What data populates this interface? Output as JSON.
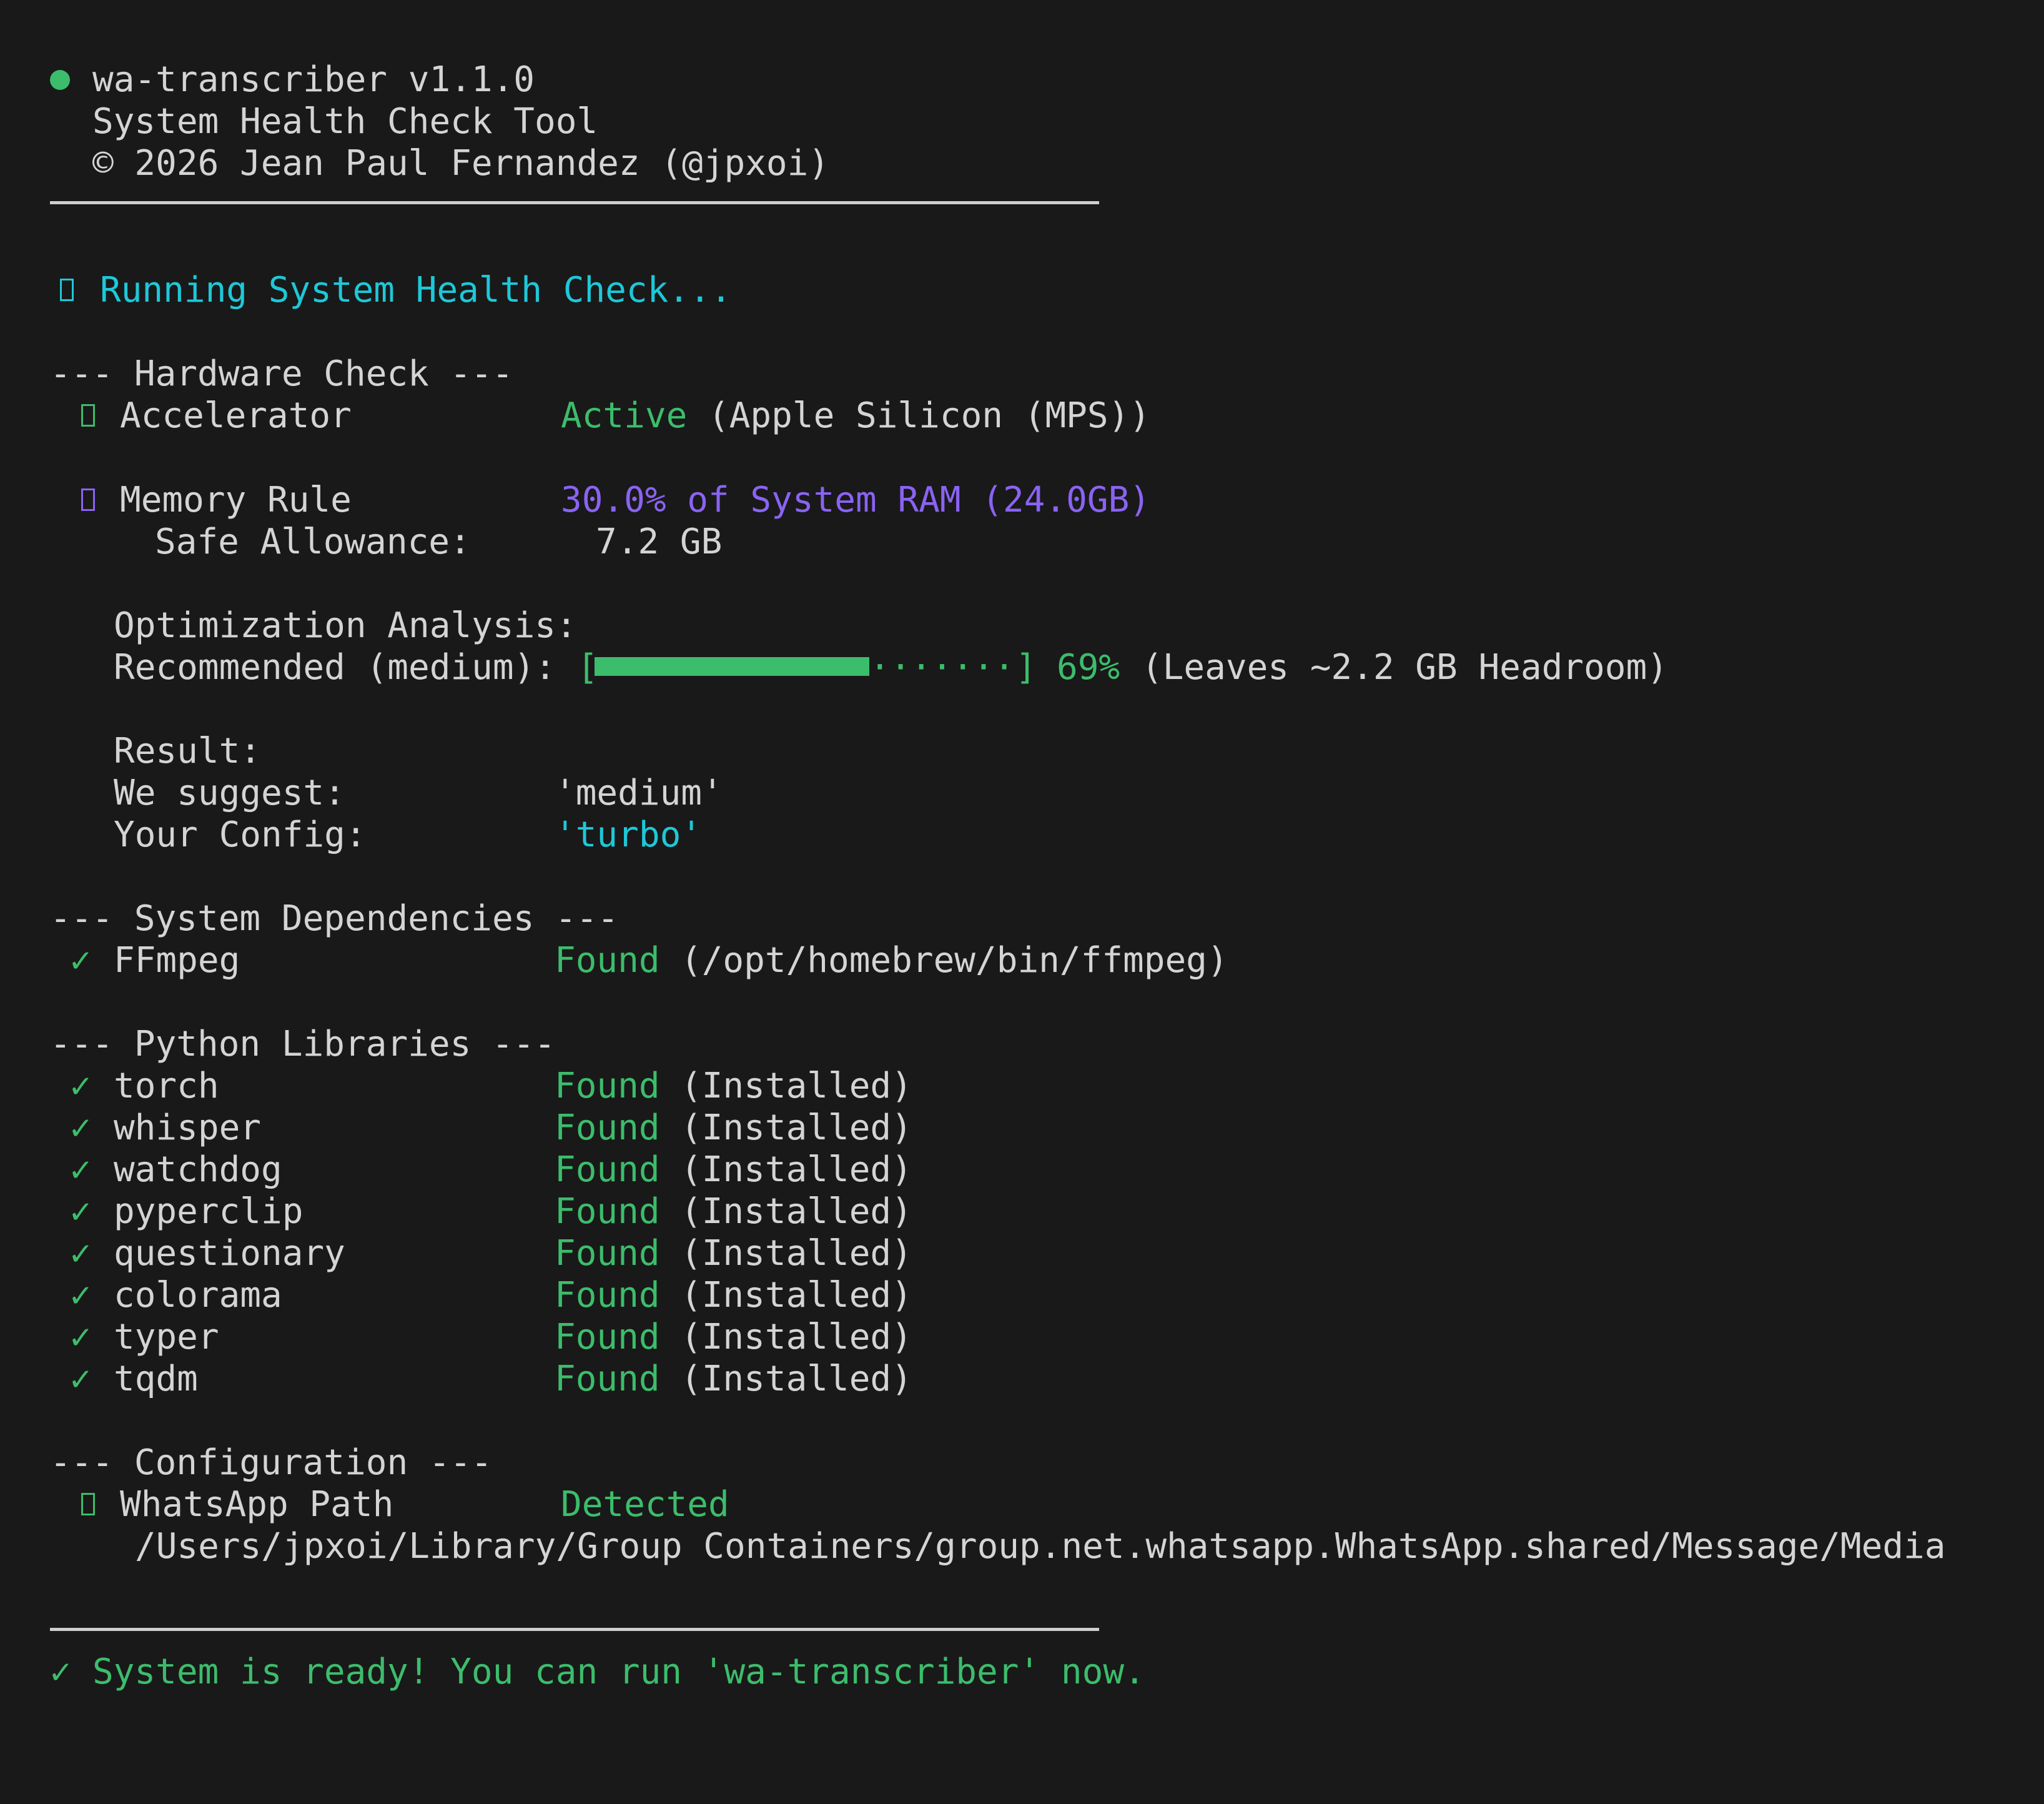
{
  "header": {
    "title": "wa-transcriber v1.1.0",
    "subtitle": "System Health Check Tool",
    "copyright": "© 2026 Jean Paul Fernandez (@jpxoi)"
  },
  "running": "Running System Health Check...",
  "hardware": {
    "heading": "--- Hardware Check ---",
    "accelerator": {
      "label": "Accelerator",
      "status": "Active",
      "detail": "(Apple Silicon (MPS))"
    },
    "memory": {
      "label": "Memory Rule",
      "value": "30.0% of System RAM (24.0GB)"
    },
    "allowance": {
      "label": "Safe Allowance:",
      "value": "7.2 GB"
    },
    "optimization_label": "Optimization Analysis:",
    "recommended": {
      "label": "Recommended (medium):",
      "bar_open": "[",
      "bar_dots": "·······",
      "bar_close": "]",
      "fill_fraction": 0.69,
      "percent": "69%",
      "note": "(Leaves ~2.2 GB Headroom)"
    },
    "result_label": "Result:",
    "suggest": {
      "label": "We suggest:",
      "value": "'medium'"
    },
    "config": {
      "label": "Your Config:",
      "value": "'turbo'"
    }
  },
  "dependencies": {
    "heading": "--- System Dependencies ---",
    "items": [
      {
        "check": "✓",
        "name": "FFmpeg",
        "status": "Found",
        "detail": "(/opt/homebrew/bin/ffmpeg)"
      }
    ]
  },
  "libraries": {
    "heading": "--- Python Libraries ---",
    "items": [
      {
        "check": "✓",
        "name": "torch",
        "status": "Found",
        "detail": "(Installed)"
      },
      {
        "check": "✓",
        "name": "whisper",
        "status": "Found",
        "detail": "(Installed)"
      },
      {
        "check": "✓",
        "name": "watchdog",
        "status": "Found",
        "detail": "(Installed)"
      },
      {
        "check": "✓",
        "name": "pyperclip",
        "status": "Found",
        "detail": "(Installed)"
      },
      {
        "check": "✓",
        "name": "questionary",
        "status": "Found",
        "detail": "(Installed)"
      },
      {
        "check": "✓",
        "name": "colorama",
        "status": "Found",
        "detail": "(Installed)"
      },
      {
        "check": "✓",
        "name": "typer",
        "status": "Found",
        "detail": "(Installed)"
      },
      {
        "check": "✓",
        "name": "tqdm",
        "status": "Found",
        "detail": "(Installed)"
      }
    ]
  },
  "configuration": {
    "heading": "--- Configuration ---",
    "whatsapp": {
      "label": "WhatsApp Path",
      "status": "Detected"
    },
    "path": "/Users/jpxoi/Library/Group Containers/group.net.whatsapp.WhatsApp.shared/Message/Media"
  },
  "footer": {
    "check": "✓",
    "message": "System is ready! You can run 'wa-transcriber' now."
  },
  "colors": {
    "background": "#191919",
    "text": "#d4d4d4",
    "green": "#3cbd6c",
    "cyan": "#1ec8d8",
    "purple": "#8a63f2"
  }
}
